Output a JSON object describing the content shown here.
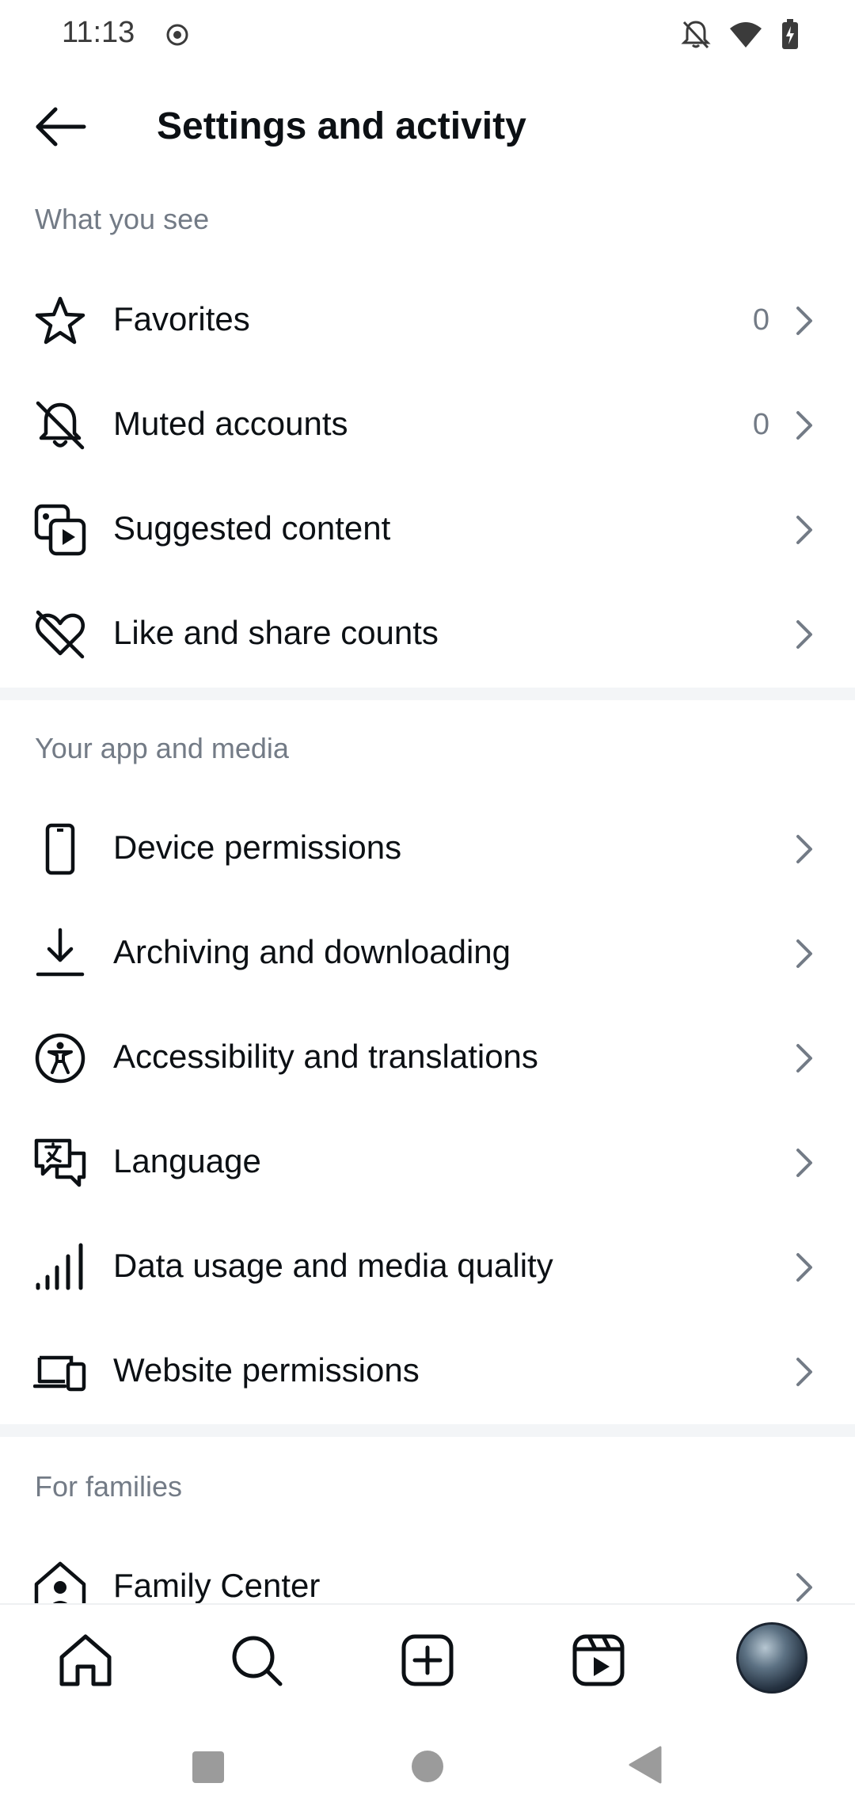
{
  "status_bar": {
    "time": "11:13",
    "icons": [
      "record-icon",
      "bell-off-icon",
      "wifi-icon",
      "battery-charging-icon"
    ]
  },
  "header": {
    "title": "Settings and activity",
    "back_icon": "arrow-left-icon"
  },
  "sections": {
    "what_you_see": {
      "heading": "What you see",
      "items": [
        {
          "label": "Favorites",
          "count": "0",
          "icon": "star-icon"
        },
        {
          "label": "Muted accounts",
          "count": "0",
          "icon": "bell-off-icon"
        },
        {
          "label": "Suggested content",
          "icon": "media-play-icon"
        },
        {
          "label": "Like and share counts",
          "icon": "heart-off-icon"
        }
      ]
    },
    "your_app_and_media": {
      "heading": "Your app and media",
      "items": [
        {
          "label": "Device permissions",
          "icon": "phone-icon"
        },
        {
          "label": "Archiving and downloading",
          "icon": "download-icon"
        },
        {
          "label": "Accessibility and translations",
          "icon": "accessibility-icon"
        },
        {
          "label": "Language",
          "icon": "translate-chat-icon"
        },
        {
          "label": "Data usage and media quality",
          "icon": "signal-bars-icon"
        },
        {
          "label": "Website permissions",
          "icon": "laptop-phone-icon"
        }
      ]
    },
    "for_families": {
      "heading": "For families",
      "items": [
        {
          "label": "Family Center",
          "icon": "family-home-icon"
        }
      ]
    }
  },
  "bottom_nav": {
    "items": [
      "home-icon",
      "search-icon",
      "create-icon",
      "reels-icon",
      "profile-avatar"
    ]
  },
  "system_nav": {
    "items": [
      "recents-square-icon",
      "home-circle-icon",
      "back-triangle-icon"
    ]
  },
  "colors": {
    "text_primary": "#0c1014",
    "text_secondary": "#737b86",
    "divider": "#f3f5f7"
  }
}
